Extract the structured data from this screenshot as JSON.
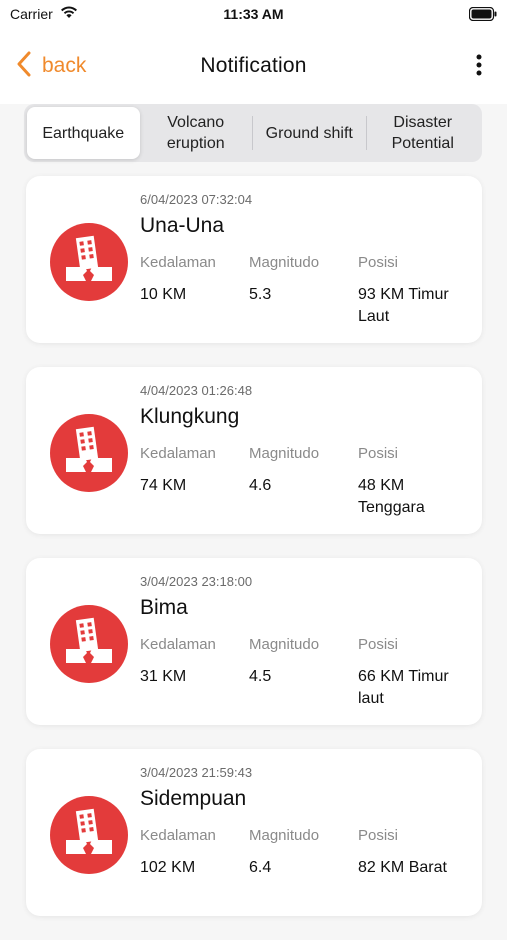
{
  "status": {
    "carrier": "Carrier",
    "time": "11:33 AM"
  },
  "nav": {
    "back_label": "back",
    "title": "Notification"
  },
  "tabs": [
    {
      "label": "Earthquake",
      "active": true
    },
    {
      "label": "Volcano\neruption",
      "active": false
    },
    {
      "label": "Ground shift",
      "active": false
    },
    {
      "label": "Disaster\nPotential",
      "active": false
    }
  ],
  "column_labels": {
    "depth": "Kedalaman",
    "magnitude": "Magnitudo",
    "position": "Posisi"
  },
  "notifications": [
    {
      "date": "6/04/2023 07:32:04",
      "place": "Una-Una",
      "depth": "10 KM",
      "magnitude": "5.3",
      "position": "93 KM Timur Laut"
    },
    {
      "date": "4/04/2023 01:26:48",
      "place": "Klungkung",
      "depth": "74 KM",
      "magnitude": "4.6",
      "position": "48 KM Tenggara"
    },
    {
      "date": "3/04/2023 23:18:00",
      "place": "Bima",
      "depth": "31 KM",
      "magnitude": "4.5",
      "position": "66 KM Timur laut"
    },
    {
      "date": "3/04/2023 21:59:43",
      "place": "Sidempuan",
      "depth": "102 KM",
      "magnitude": "6.4",
      "position": "82 KM Barat"
    }
  ],
  "colors": {
    "accent": "#f08a2c",
    "quake_icon": "#e33b3b"
  },
  "icons": {
    "back": "chevron-left-icon",
    "more": "more-vertical-icon",
    "notification": "earthquake-building-icon"
  }
}
